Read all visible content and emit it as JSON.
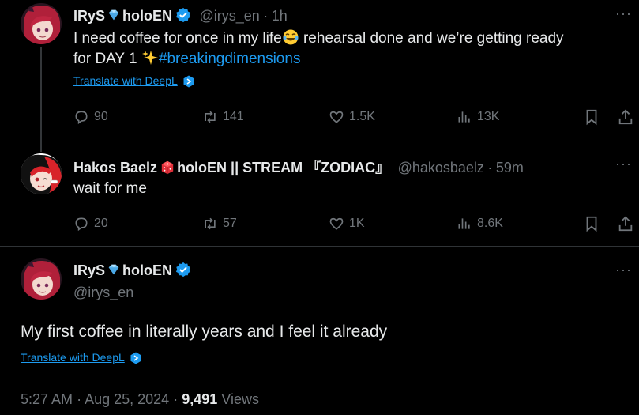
{
  "tweets": [
    {
      "author": "IRyS",
      "author_suffix": "holoEN",
      "handle": "@irys_en",
      "sep": "·",
      "time": "1h",
      "text_part1": "I need coffee for once in my life",
      "text_part2": " rehearsal done and we’re getting ready",
      "text_line2": "for DAY 1 ",
      "hashtag": "#breakingdimensions",
      "translate": "Translate with DeepL",
      "replies": "90",
      "reposts": "141",
      "likes": "1.5K",
      "views": "13K"
    },
    {
      "author": "Hakos Baelz",
      "author_suffix": "holoEN || STREAM 『ZODIAC』",
      "handle": "@hakosbaelz",
      "sep": "·",
      "time": "59m",
      "text": "wait for me",
      "replies": "20",
      "reposts": "57",
      "likes": "1K",
      "views": "8.6K"
    }
  ],
  "main": {
    "author": "IRyS",
    "author_suffix": "holoEN",
    "handle": "@irys_en",
    "text": "My first coffee in literally years and I feel it already",
    "translate": "Translate with DeepL",
    "time": "5:27 AM",
    "sep": "·",
    "date": "Aug 25, 2024",
    "views_count": "9,491",
    "views_label": "Views"
  },
  "more_label": "···",
  "colors": {
    "accent": "#1d9bf0",
    "muted": "#71767b",
    "text": "#e7e9ea",
    "divider": "#2f3336"
  }
}
